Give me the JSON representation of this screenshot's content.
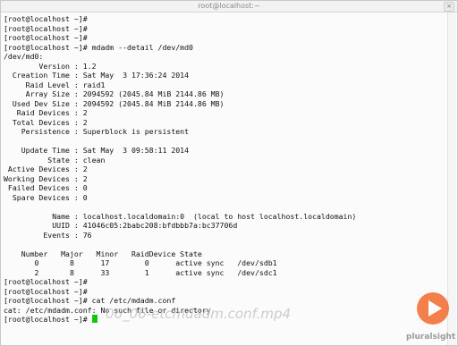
{
  "window": {
    "title": "root@localhost:~",
    "close_glyph": "×"
  },
  "terminal": {
    "lines": [
      "[root@localhost ~]#",
      "[root@localhost ~]#",
      "[root@localhost ~]#",
      "[root@localhost ~]# mdadm --detail /dev/md0",
      "/dev/md0:",
      "        Version : 1.2",
      "  Creation Time : Sat May  3 17:36:24 2014",
      "     Raid Level : raid1",
      "     Array Size : 2094592 (2045.84 MiB 2144.86 MB)",
      "  Used Dev Size : 2094592 (2045.84 MiB 2144.86 MB)",
      "   Raid Devices : 2",
      "  Total Devices : 2",
      "    Persistence : Superblock is persistent",
      "",
      "    Update Time : Sat May  3 09:58:11 2014",
      "          State : clean",
      " Active Devices : 2",
      "Working Devices : 2",
      " Failed Devices : 0",
      "  Spare Devices : 0",
      "",
      "           Name : localhost.localdomain:0  (local to host localhost.localdomain)",
      "           UUID : 41046c05:2babc208:bfdbbb7a:bc37706d",
      "         Events : 76",
      "",
      "    Number   Major   Minor   RaidDevice State",
      "       0       8      17        0      active sync   /dev/sdb1",
      "       2       8      33        1      active sync   /dev/sdc1",
      "[root@localhost ~]#",
      "[root@localhost ~]#",
      "[root@localhost ~]# cat /etc/mdadm.conf",
      "cat: /etc/mdadm.conf: No such file or directory",
      "[root@localhost ~]# "
    ]
  },
  "overlay": {
    "watermark": "06_06-etcmdadm.conf.mp4",
    "brand": "pluralsight",
    "colors": {
      "accent": "#f26b2c",
      "cursor": "#12c712"
    }
  }
}
